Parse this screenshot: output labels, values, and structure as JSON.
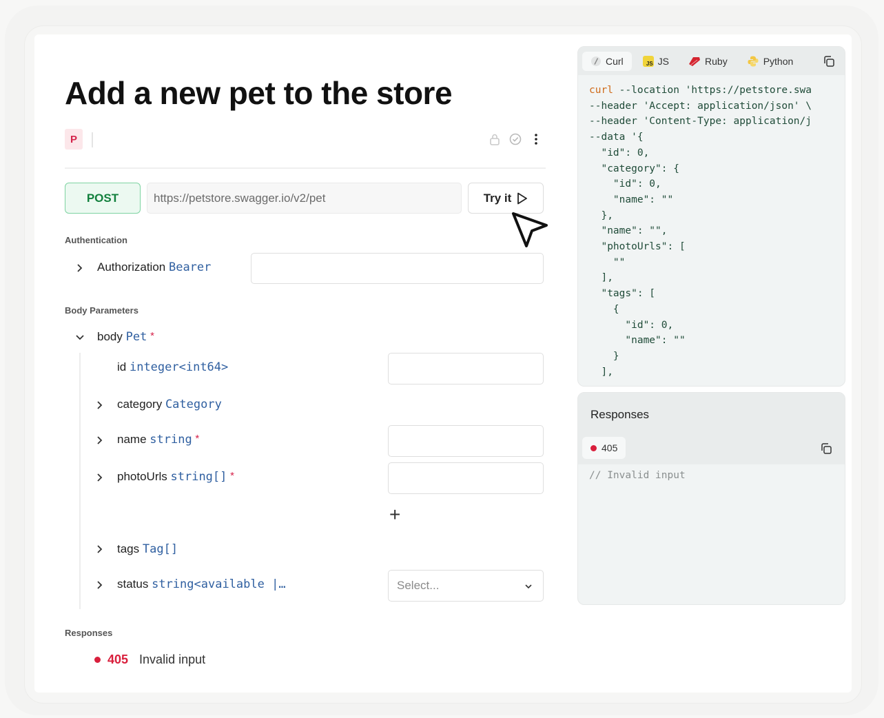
{
  "page": {
    "title": "Add a new pet to the store",
    "badge": "P"
  },
  "request": {
    "method": "POST",
    "url": "https://petstore.swagger.io/v2/pet",
    "try_label": "Try it"
  },
  "auth": {
    "section_label": "Authentication",
    "name": "Authorization",
    "type": "Bearer"
  },
  "body": {
    "section_label": "Body Parameters",
    "root": {
      "name": "body",
      "type": "Pet",
      "required": "*"
    },
    "fields": [
      {
        "name": "id",
        "type": "integer<int64>",
        "required": ""
      },
      {
        "name": "category",
        "type": "Category",
        "required": ""
      },
      {
        "name": "name",
        "type": "string",
        "required": "*"
      },
      {
        "name": "photoUrls",
        "type": "string[]",
        "required": "*"
      },
      {
        "name": "tags",
        "type": "Tag[]",
        "required": ""
      },
      {
        "name": "status",
        "type": "string<available  |…",
        "required": ""
      }
    ],
    "select_placeholder": "Select...",
    "add_symbol": "+"
  },
  "responses": {
    "section_label": "Responses",
    "items": [
      {
        "code": "405",
        "description": "Invalid input"
      }
    ]
  },
  "code_panel": {
    "tabs": [
      "Curl",
      "JS",
      "Ruby",
      "Python"
    ],
    "active_tab": "Curl",
    "lines": [
      {
        "kw": "curl",
        "rest": " --location 'https://petstore.swa"
      },
      {
        "kw": "",
        "rest": "--header 'Accept: application/json' \\"
      },
      {
        "kw": "",
        "rest": "--header 'Content-Type: application/j"
      },
      {
        "kw": "",
        "rest": "--data '{"
      },
      {
        "kw": "",
        "rest": "  \"id\": 0,"
      },
      {
        "kw": "",
        "rest": "  \"category\": {"
      },
      {
        "kw": "",
        "rest": "    \"id\": 0,"
      },
      {
        "kw": "",
        "rest": "    \"name\": \"\""
      },
      {
        "kw": "",
        "rest": "  },"
      },
      {
        "kw": "",
        "rest": "  \"name\": \"\","
      },
      {
        "kw": "",
        "rest": "  \"photoUrls\": ["
      },
      {
        "kw": "",
        "rest": "    \"\""
      },
      {
        "kw": "",
        "rest": "  ],"
      },
      {
        "kw": "",
        "rest": "  \"tags\": ["
      },
      {
        "kw": "",
        "rest": "    {"
      },
      {
        "kw": "",
        "rest": "      \"id\": 0,"
      },
      {
        "kw": "",
        "rest": "      \"name\": \"\""
      },
      {
        "kw": "",
        "rest": "    }"
      },
      {
        "kw": "",
        "rest": "  ],"
      }
    ]
  },
  "responses_panel": {
    "title": "Responses",
    "code": "405",
    "body": "// Invalid input"
  },
  "colors": {
    "post_green": "#12803d",
    "error_red": "#d91f3c",
    "type_blue": "#2f5fa0",
    "code_keyword": "#cf6a18"
  }
}
